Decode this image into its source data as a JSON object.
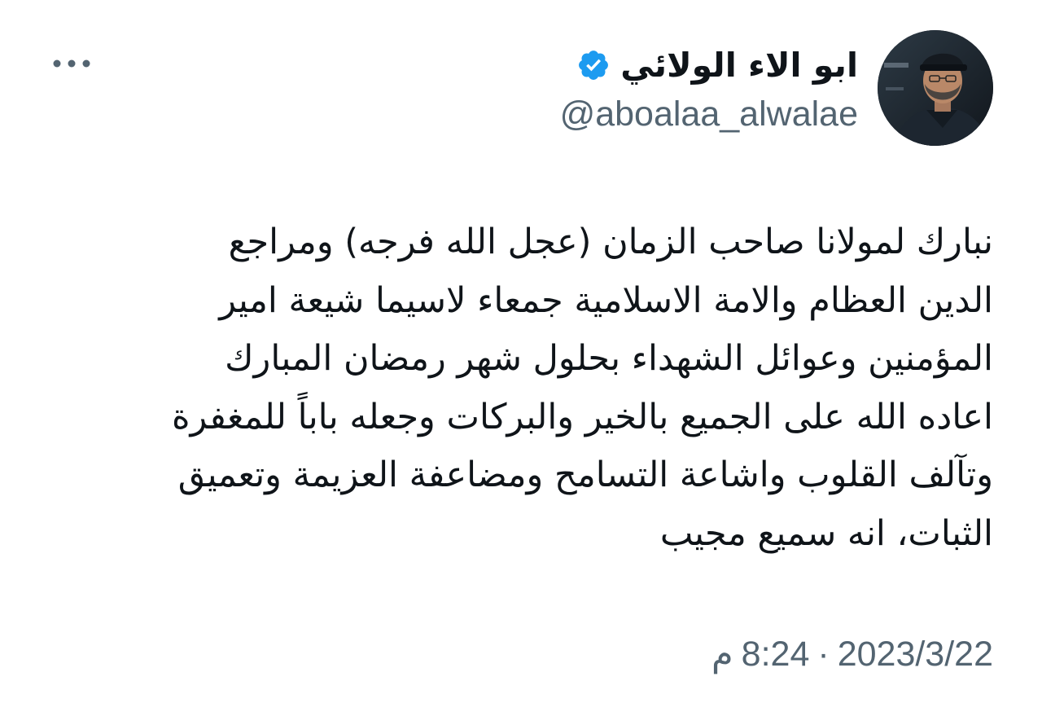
{
  "author": {
    "display_name": "ابو الاء الولائي",
    "handle": "@aboalaa_alwalae",
    "verified_icon": "verified-badge-icon",
    "avatar_icon": "profile-photo",
    "accent_color": "#1d9bf0"
  },
  "menu": {
    "more_icon": "more-horizontal-icon"
  },
  "tweet": {
    "lines": [
      "نبارك لمولانا صاحب الزمان (عجل الله فرجه) ومراجع",
      "الدين العظام والامة الاسلامية جمعاء لاسيما شيعة امير",
      "المؤمنين وعوائل الشهداء بحلول شهر رمضان المبارك",
      "اعاده الله على الجميع بالخير والبركات وجعله باباً للمغفرة",
      "وتآلف القلوب واشاعة التسامح ومضاعفة العزيمة وتعميق",
      "الثبات، انه سميع مجيب"
    ]
  },
  "meta": {
    "time": "8:24",
    "ampm": "م",
    "separator": "·",
    "date": "2023/3/22"
  },
  "colors": {
    "text": "#0f1419",
    "secondary": "#536471",
    "background": "#ffffff"
  }
}
